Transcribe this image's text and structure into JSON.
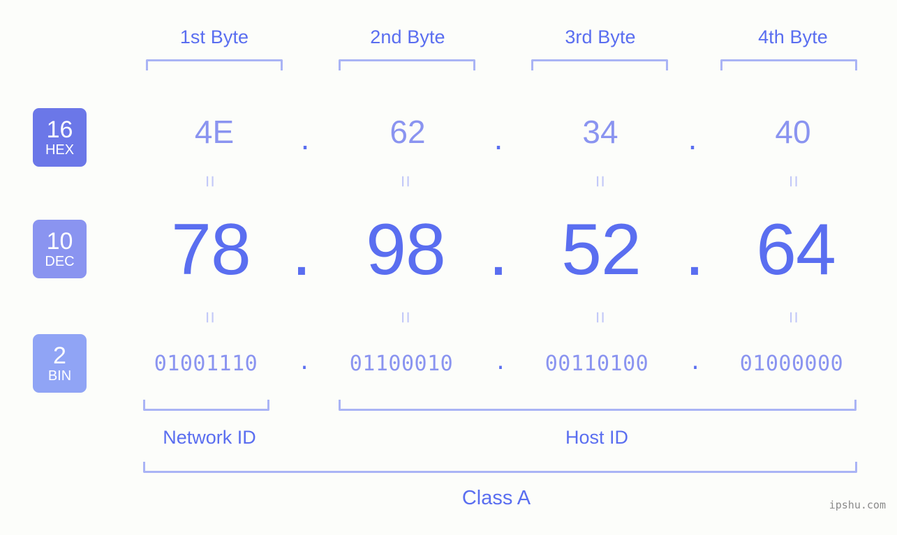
{
  "meta": {
    "ip_address": "78.98.52.64",
    "background_color": "#fcfdfa",
    "accent_dark": "#5a6ef0",
    "accent_light": "#8a94f0",
    "bracket_color": "#aab4f5",
    "equals_color": "#c3c9f8",
    "watermark_color": "#8a8a8a"
  },
  "byte_headers": [
    {
      "label": "1st Byte"
    },
    {
      "label": "2nd Byte"
    },
    {
      "label": "3rd Byte"
    },
    {
      "label": "4th Byte"
    }
  ],
  "badges": [
    {
      "base": "16",
      "system": "HEX",
      "color": "#6b77e8"
    },
    {
      "base": "10",
      "system": "DEC",
      "color": "#8a94f0"
    },
    {
      "base": "2",
      "system": "BIN",
      "color": "#90a4f5"
    }
  ],
  "rows": {
    "hex": {
      "values": [
        "4E",
        "62",
        "34",
        "40"
      ],
      "separator": "."
    },
    "dec": {
      "values": [
        "78",
        "98",
        "52",
        "64"
      ],
      "separator": "."
    },
    "bin": {
      "values": [
        "01001110",
        "01100010",
        "00110100",
        "01000000"
      ],
      "separator": "."
    }
  },
  "equals": {
    "mark": "="
  },
  "sections": [
    {
      "label": "Network ID"
    },
    {
      "label": "Host ID"
    }
  ],
  "class": {
    "label": "Class A"
  },
  "watermark": {
    "text": "ipshu.com"
  }
}
